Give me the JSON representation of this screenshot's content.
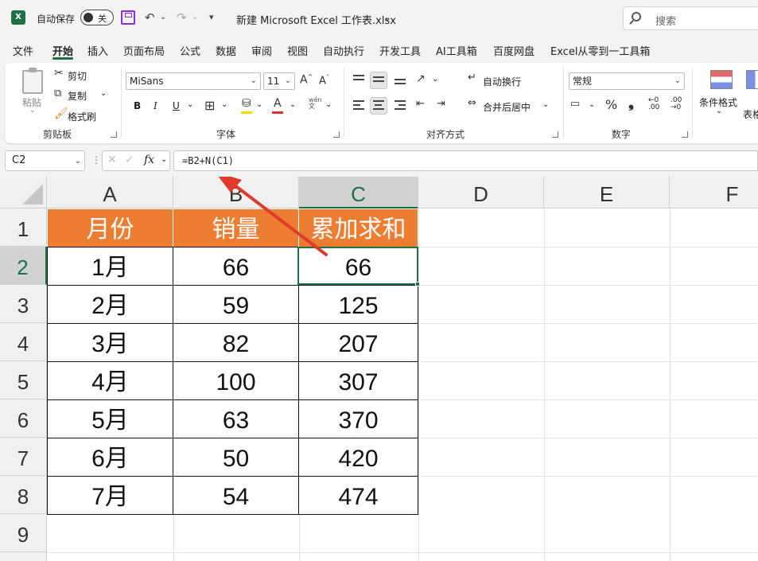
{
  "titlebar": {
    "autosave_label": "自动保存",
    "autosave_state": "关",
    "doc_title": "新建 Microsoft Excel 工作表.xlsx",
    "search_placeholder": "搜索"
  },
  "tabs": [
    "文件",
    "开始",
    "插入",
    "页面布局",
    "公式",
    "数据",
    "审阅",
    "视图",
    "自动执行",
    "开发工具",
    "AI工具箱",
    "百度网盘",
    "Excel从零到一工具箱"
  ],
  "active_tab": "开始",
  "ribbon": {
    "clipboard": {
      "paste": "粘贴",
      "cut": "剪切",
      "copy": "复制",
      "format_painter": "格式刷",
      "label": "剪贴板"
    },
    "font": {
      "name": "MiSans",
      "size": "11",
      "bold": "B",
      "italic": "I",
      "underline": "U",
      "label": "字体",
      "font_color": "#e03030",
      "fill_color": "#ffd700"
    },
    "alignment": {
      "wrap": "自动换行",
      "merge": "合并后居中",
      "label": "对齐方式"
    },
    "number": {
      "format": "常规",
      "percent": "%",
      "comma": "❟",
      "label": "数字"
    },
    "styles": {
      "conditional": "条件格式",
      "table": "表格"
    }
  },
  "formula_bar": {
    "name_box": "C2",
    "fx": "fx",
    "formula": "=B2+N(C1)"
  },
  "columns": [
    "A",
    "B",
    "C",
    "D",
    "E",
    "F"
  ],
  "selected_column": "C",
  "rows": [
    "1",
    "2",
    "3",
    "4",
    "5",
    "6",
    "7",
    "8",
    "9"
  ],
  "selected_row": "2",
  "table": {
    "header": [
      "月份",
      "销量",
      "累加求和"
    ],
    "header_color": "#ed7d31",
    "body": [
      [
        "1月",
        "66",
        "66"
      ],
      [
        "2月",
        "59",
        "125"
      ],
      [
        "3月",
        "82",
        "207"
      ],
      [
        "4月",
        "100",
        "307"
      ],
      [
        "5月",
        "63",
        "370"
      ],
      [
        "6月",
        "50",
        "420"
      ],
      [
        "7月",
        "54",
        "474"
      ]
    ]
  },
  "accent_color": "#1e7145",
  "annotation_arrow_color": "#e03a2e"
}
